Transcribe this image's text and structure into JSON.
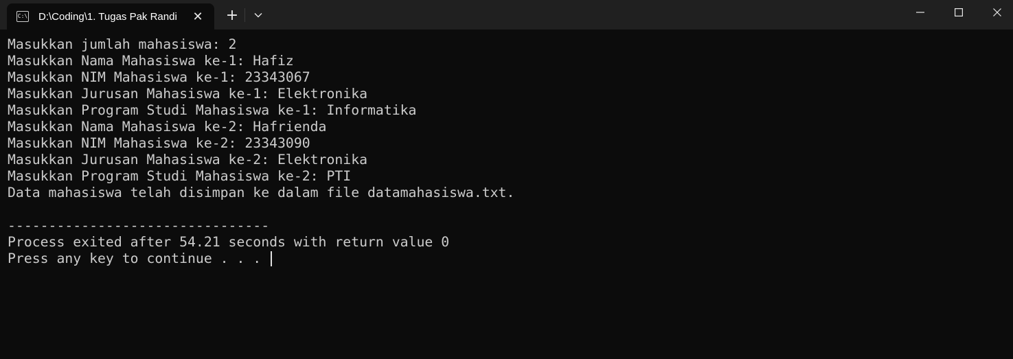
{
  "window": {
    "tab_title": "D:\\Coding\\1. Tugas Pak Randi",
    "tab_icon_text": "C:\\"
  },
  "terminal": {
    "lines": [
      "Masukkan jumlah mahasiswa: 2",
      "Masukkan Nama Mahasiswa ke-1: Hafiz",
      "Masukkan NIM Mahasiswa ke-1: 23343067",
      "Masukkan Jurusan Mahasiswa ke-1: Elektronika",
      "Masukkan Program Studi Mahasiswa ke-1: Informatika",
      "Masukkan Nama Mahasiswa ke-2: Hafrienda",
      "Masukkan NIM Mahasiswa ke-2: 23343090",
      "Masukkan Jurusan Mahasiswa ke-2: Elektronika",
      "Masukkan Program Studi Mahasiswa ke-2: PTI",
      "Data mahasiswa telah disimpan ke dalam file datamahasiswa.txt.",
      "",
      "--------------------------------",
      "Process exited after 54.21 seconds with return value 0",
      "Press any key to continue . . . "
    ]
  },
  "icons": {
    "tab": "terminal-app-icon",
    "close_tab": "close-icon",
    "new_tab": "plus-icon",
    "dropdown": "chevron-down-icon",
    "minimize": "minimize-icon",
    "maximize": "maximize-icon",
    "close_window": "close-icon"
  },
  "colors": {
    "background": "#0c0c0c",
    "titlebar": "#202020",
    "text": "#cccccc"
  }
}
